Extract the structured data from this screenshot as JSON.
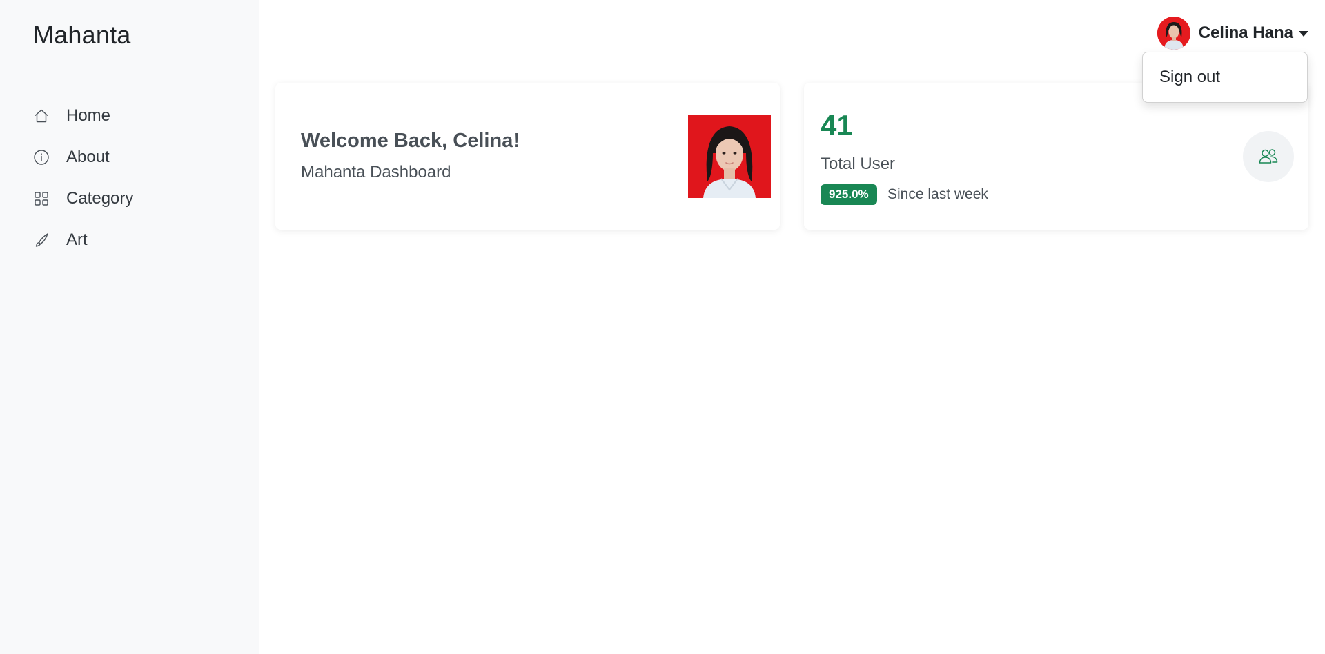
{
  "sidebar": {
    "brand": "Mahanta",
    "items": [
      {
        "label": "Home",
        "icon": "home-icon"
      },
      {
        "label": "About",
        "icon": "info-icon"
      },
      {
        "label": "Category",
        "icon": "grid-icon"
      },
      {
        "label": "Art",
        "icon": "brush-icon"
      }
    ]
  },
  "header": {
    "user_name": "Celina Hana",
    "avatar_icon": "avatar-photo",
    "dropdown": {
      "items": [
        {
          "label": "Sign out"
        }
      ]
    }
  },
  "welcome_card": {
    "title": "Welcome Back, Celina!",
    "subtitle": "Mahanta Dashboard",
    "photo": "profile-photo"
  },
  "stat_card": {
    "value": "41",
    "label": "Total User",
    "badge": "925.0%",
    "since": "Since last week",
    "icon": "users-icon"
  },
  "colors": {
    "accent": "#198754",
    "sidebar_bg": "#f8f9fa",
    "photo_bg": "#e0161c"
  }
}
